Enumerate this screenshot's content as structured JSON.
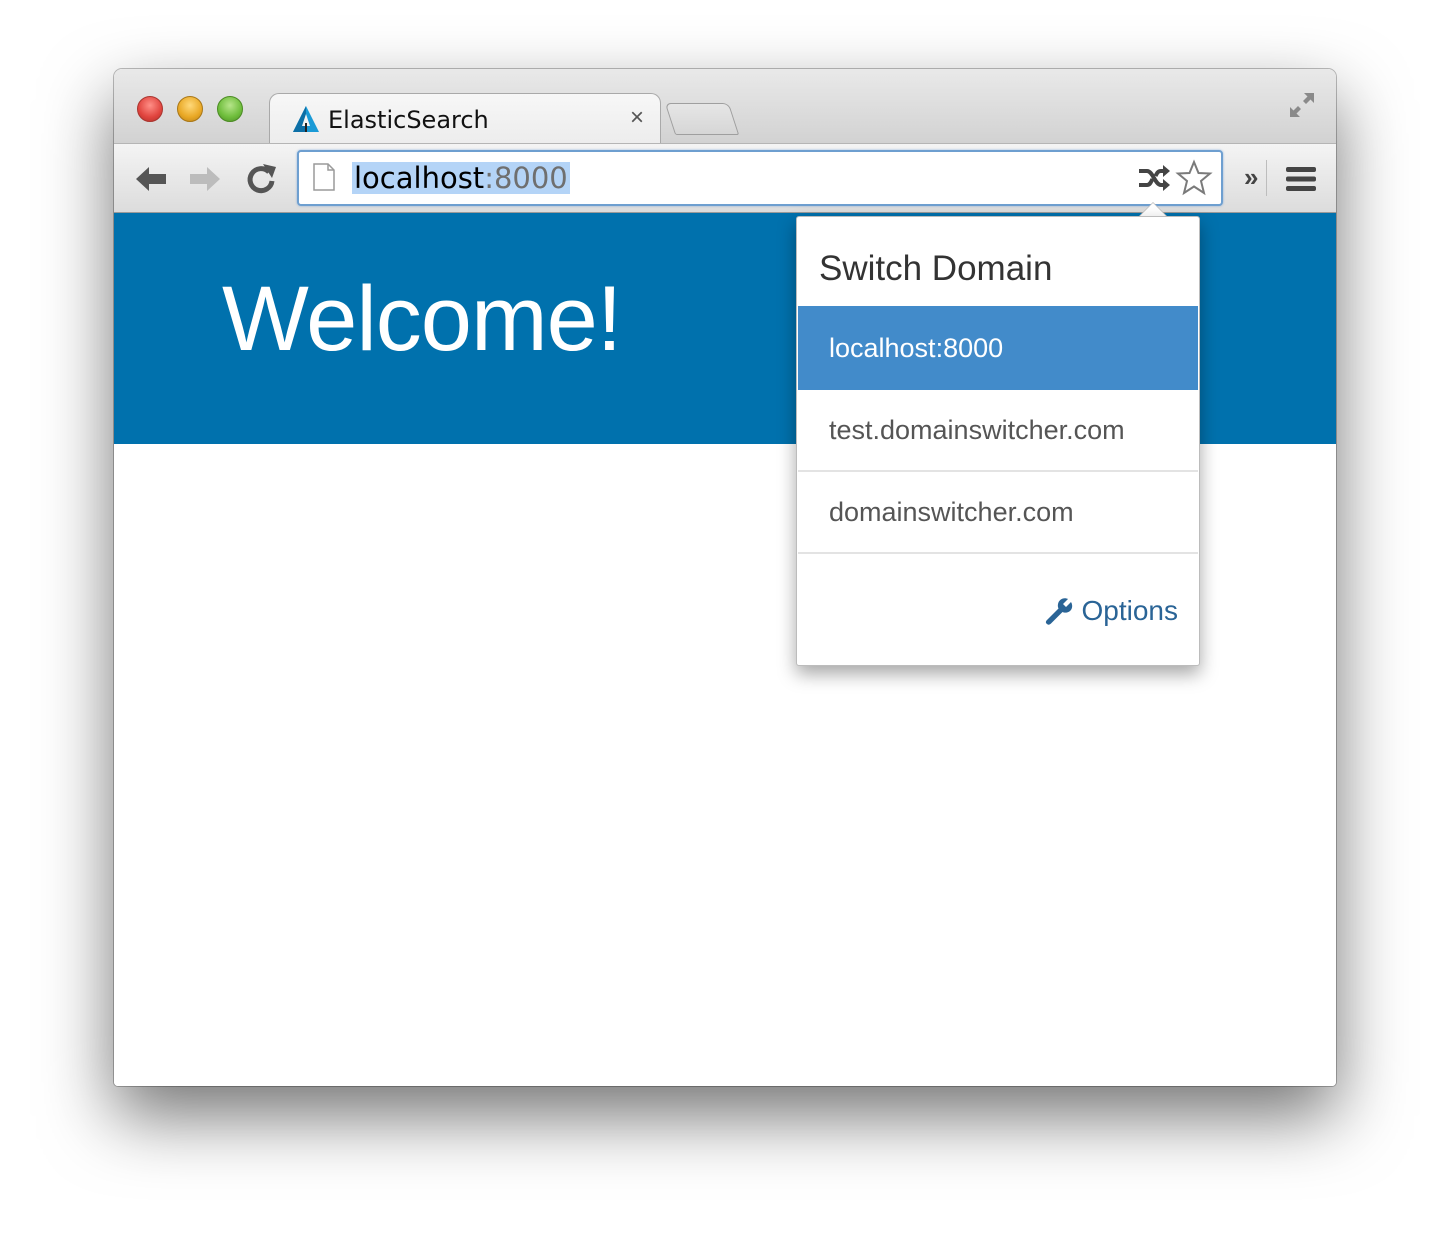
{
  "browser": {
    "tab": {
      "title": "ElasticSearch",
      "close_glyph": "×",
      "favicon": "elasticsearch-icon"
    },
    "address": {
      "host": "localhost",
      "port": ":8000"
    },
    "toolbar": {
      "overflow_label": "»"
    }
  },
  "page": {
    "hero_title": "Welcome!",
    "hero_color": "#0071ad"
  },
  "popup": {
    "title": "Switch Domain",
    "domains": [
      {
        "label": "localhost:8000",
        "active": true
      },
      {
        "label": "test.domainswitcher.com",
        "active": false
      },
      {
        "label": "domainswitcher.com",
        "active": false
      }
    ],
    "options_label": "Options",
    "accent_color": "#428bca"
  }
}
